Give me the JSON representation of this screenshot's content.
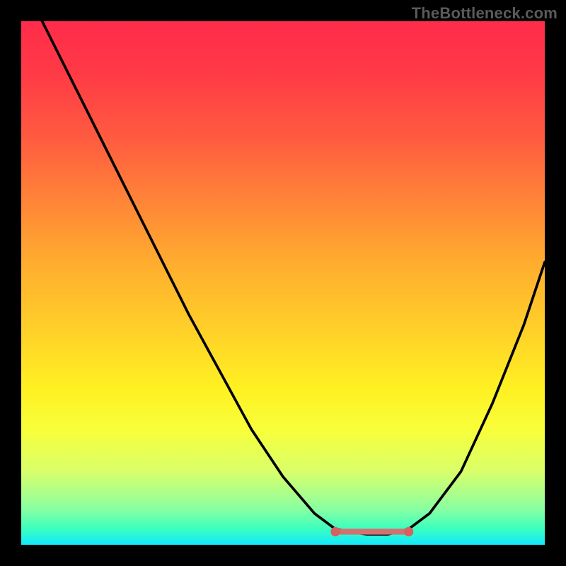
{
  "watermark": "TheBottleneck.com",
  "chart_data": {
    "type": "line",
    "title": "",
    "xlabel": "",
    "ylabel": "",
    "xlim": [
      0,
      100
    ],
    "ylim": [
      0,
      100
    ],
    "series": [
      {
        "name": "curve",
        "points": [
          {
            "x": 4,
            "y": 100
          },
          {
            "x": 8,
            "y": 92
          },
          {
            "x": 14,
            "y": 80
          },
          {
            "x": 20,
            "y": 68
          },
          {
            "x": 26,
            "y": 56
          },
          {
            "x": 32,
            "y": 44
          },
          {
            "x": 38,
            "y": 33
          },
          {
            "x": 44,
            "y": 22
          },
          {
            "x": 50,
            "y": 13
          },
          {
            "x": 56,
            "y": 6
          },
          {
            "x": 60,
            "y": 3
          },
          {
            "x": 66,
            "y": 2
          },
          {
            "x": 70,
            "y": 2
          },
          {
            "x": 74,
            "y": 3
          },
          {
            "x": 78,
            "y": 6
          },
          {
            "x": 84,
            "y": 14
          },
          {
            "x": 90,
            "y": 27
          },
          {
            "x": 96,
            "y": 42
          },
          {
            "x": 100,
            "y": 54
          }
        ]
      },
      {
        "name": "floor-marker",
        "points": [
          {
            "x": 60,
            "y": 2.5
          },
          {
            "x": 74,
            "y": 2.5
          }
        ]
      }
    ],
    "annotations": {
      "left_dot": {
        "x": 60,
        "y": 2.5
      },
      "right_dot": {
        "x": 74,
        "y": 2.5
      }
    },
    "colors": {
      "curve": "#000000",
      "floor_marker": "#d47070",
      "dot": "#d86060"
    }
  }
}
